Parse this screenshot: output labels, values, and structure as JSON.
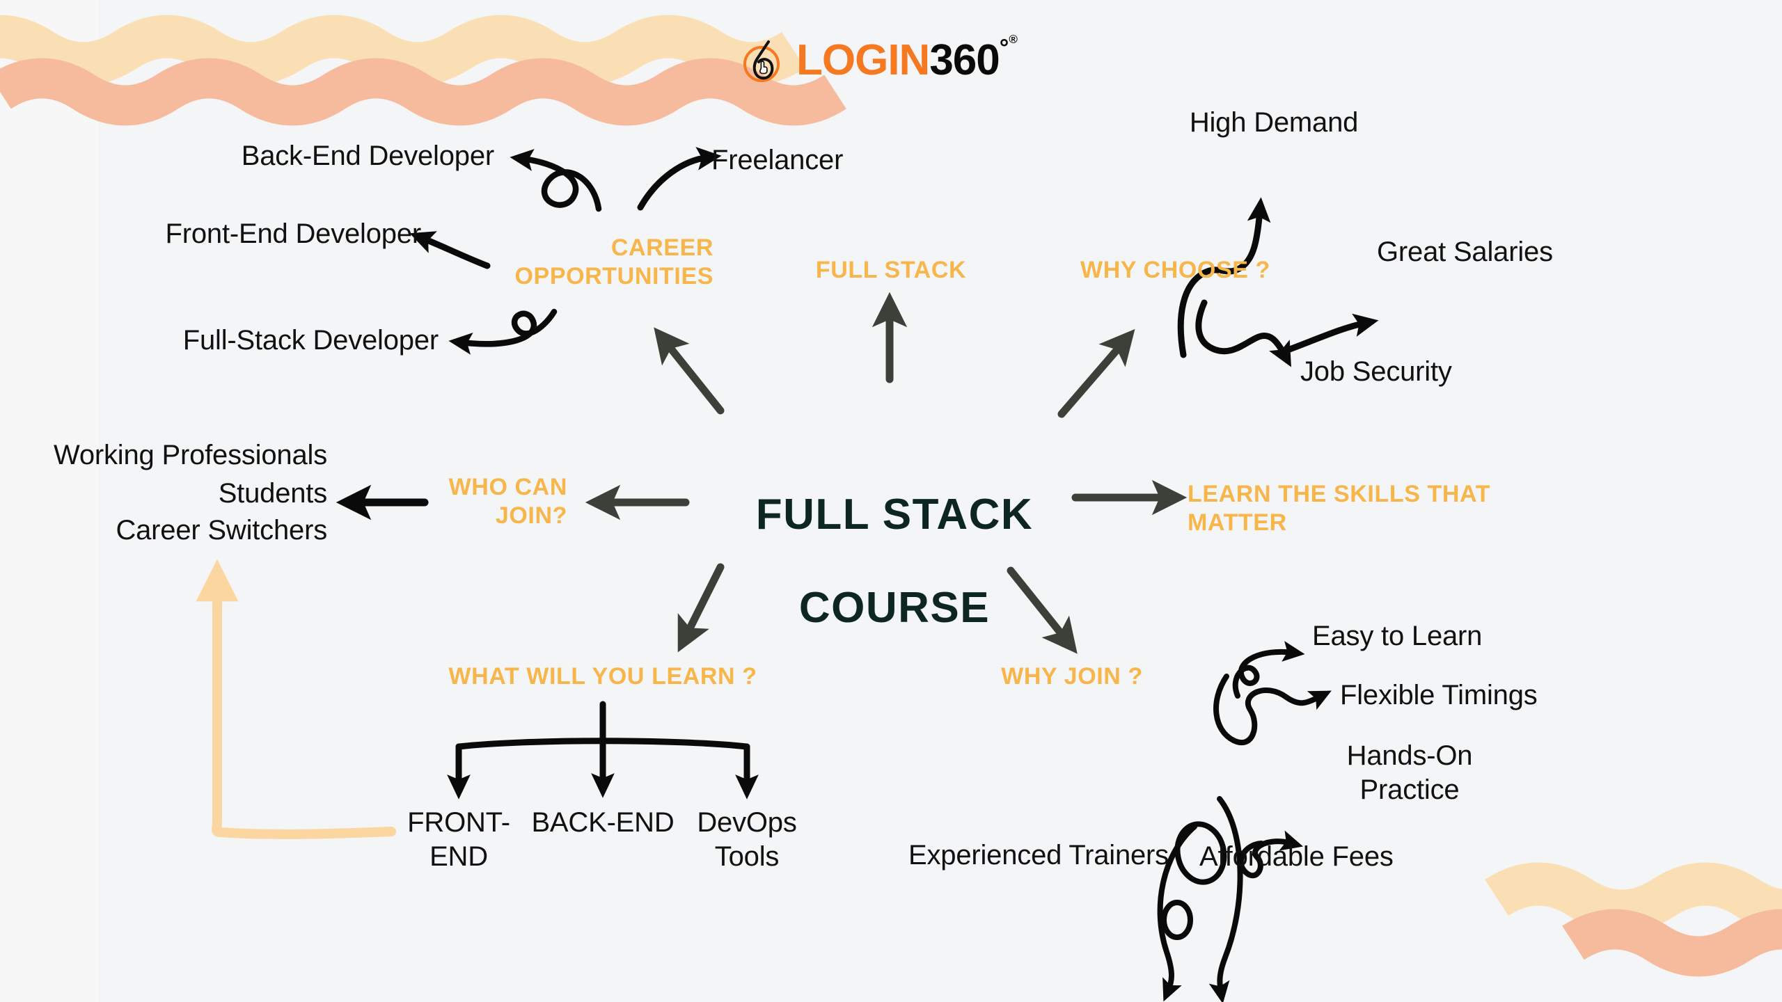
{
  "page": {
    "background_color": "#f4f5f6",
    "accent_color": "#f7b54a",
    "center_color": "#0d2620",
    "leaf_color": "#111111",
    "arrow_dark_color": "#3d4038",
    "arrow_black_color": "#0a0a0a",
    "arrow_peach_color": "#fbd6a0"
  },
  "logo": {
    "icon": "login360-six-hand-icon",
    "word_primary": "LOGIN",
    "word_secondary": "360",
    "degree_symbol": "°",
    "registered_symbol": "®"
  },
  "center": {
    "title_line1": "FULL STACK",
    "title_line2": "COURSE"
  },
  "branches": [
    {
      "id": "career-opportunities",
      "label": "CAREER\nOPPORTUNITIES",
      "leaves": [
        "Back-End Developer",
        "Freelancer",
        "Front-End Developer",
        "Full-Stack Developer"
      ]
    },
    {
      "id": "full-stack",
      "label": "FULL STACK",
      "leaves": []
    },
    {
      "id": "why-choose",
      "label": "WHY CHOOSE ?",
      "leaves": [
        "High Demand",
        "Great Salaries",
        "Job Security"
      ]
    },
    {
      "id": "learn-the-skills-that-matter",
      "label": "LEARN THE SKILLS THAT\nMATTER",
      "leaves": []
    },
    {
      "id": "who-can-join",
      "label": "WHO CAN\nJOIN?",
      "leaves": [
        "Working Professionals",
        "Students",
        "Career Switchers"
      ]
    },
    {
      "id": "what-will-you-learn",
      "label": "WHAT WILL YOU LEARN ?",
      "leaves": [
        "FRONT-\nEND",
        "BACK-END",
        "DevOps\nTools"
      ]
    },
    {
      "id": "why-join",
      "label": "WHY JOIN ?",
      "leaves": [
        "Easy to Learn",
        "Flexible Timings",
        "Hands-On\nPractice",
        "Experienced Trainers",
        "Affordable Fees"
      ]
    }
  ],
  "nodes": {
    "back_end_developer": "Back-End Developer",
    "freelancer": "Freelancer",
    "front_end_developer": "Front-End Developer",
    "full_stack_developer": "Full-Stack Developer",
    "career_opportunities": "CAREER\nOPPORTUNITIES",
    "full_stack": "FULL STACK",
    "why_choose": "WHY CHOOSE ?",
    "high_demand": "High Demand",
    "great_salaries": "Great Salaries",
    "job_security": "Job Security",
    "learn_skills": "LEARN THE SKILLS THAT\nMATTER",
    "who_can_join": "WHO CAN\nJOIN?",
    "working_professionals": "Working Professionals",
    "students": "Students",
    "career_switchers": "Career Switchers",
    "what_will_you_learn": "WHAT WILL YOU LEARN ?",
    "front_end": "FRONT-\nEND",
    "back_end": "BACK-END",
    "devops_tools": "DevOps\nTools",
    "why_join": "WHY JOIN ?",
    "easy_to_learn": "Easy to Learn",
    "flexible_timings": "Flexible Timings",
    "hands_on_practice": "Hands-On\nPractice",
    "experienced_trainers": "Experienced Trainers",
    "affordable_fees": "Affordable Fees"
  },
  "decorations": {
    "wave_top_left_cream": "#fbdfb4",
    "wave_top_left_salmon": "#f6bb9c",
    "wave_bottom_right_cream": "#fbdfb4",
    "wave_bottom_right_salmon": "#f6bb9c",
    "corner_arrow_left": "peach-l-shaped-up-arrow"
  }
}
